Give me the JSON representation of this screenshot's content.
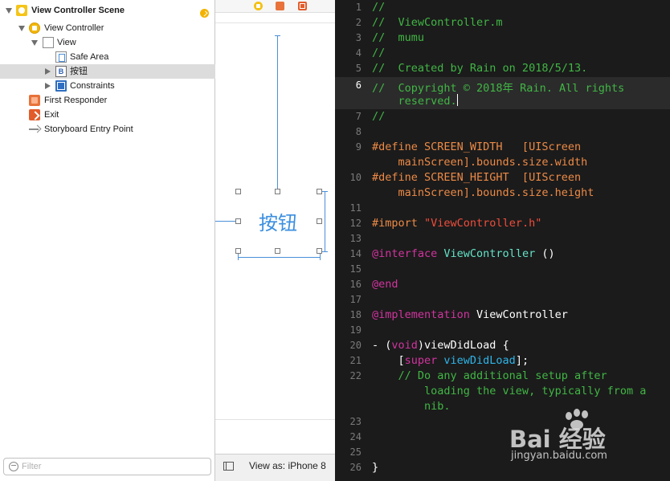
{
  "outline": {
    "items": [
      {
        "label": "View Controller Scene",
        "icon": "scene-icon"
      },
      {
        "label": "View Controller",
        "icon": "view-controller-icon"
      },
      {
        "label": "View",
        "icon": "view-icon"
      },
      {
        "label": "Safe Area",
        "icon": "safe-area-icon"
      },
      {
        "label": "按钮",
        "icon": "button-icon",
        "icon_text": "B",
        "selected": true
      },
      {
        "label": "Constraints",
        "icon": "constraints-icon"
      },
      {
        "label": "First Responder",
        "icon": "first-responder-icon"
      },
      {
        "label": "Exit",
        "icon": "exit-icon"
      },
      {
        "label": "Storyboard Entry Point",
        "icon": "entry-arrow-icon"
      }
    ],
    "filter_placeholder": "Filter"
  },
  "canvas": {
    "button_title": "按钮",
    "view_as_label": "View as: iPhone 8"
  },
  "editor": {
    "lines": [
      {
        "num": "1",
        "text": "//"
      },
      {
        "num": "2",
        "text": "//  ViewController.m"
      },
      {
        "num": "3",
        "text": "//  mumu"
      },
      {
        "num": "4",
        "text": "//"
      },
      {
        "num": "5",
        "text": "//  Created by Rain on 2018/5/13."
      },
      {
        "num": "6",
        "text": "//  Copyright © 2018年 Rain. All rights",
        "cont": "    reserved."
      },
      {
        "num": "7",
        "text": "//"
      },
      {
        "num": "8",
        "text": ""
      },
      {
        "num": "9",
        "text": "#define SCREEN_WIDTH   [UIScreen",
        "cont": "    mainScreen].bounds.size.width"
      },
      {
        "num": "10",
        "text": "#define SCREEN_HEIGHT  [UIScreen",
        "cont": "    mainScreen].bounds.size.height"
      },
      {
        "num": "11",
        "text": ""
      },
      {
        "num": "12",
        "kw": "#import ",
        "str": "\"ViewController.h\""
      },
      {
        "num": "13",
        "text": ""
      },
      {
        "num": "14",
        "kw": "@interface",
        "typ": " ViewController",
        "plain": " ()"
      },
      {
        "num": "15",
        "text": ""
      },
      {
        "num": "16",
        "kw": "@end"
      },
      {
        "num": "17",
        "text": ""
      },
      {
        "num": "18",
        "kw": "@implementation",
        "plain": " ViewController"
      },
      {
        "num": "19",
        "text": ""
      },
      {
        "num": "20",
        "p1": "- (",
        "kw": "void",
        "p2": ")viewDidLoad {"
      },
      {
        "num": "21",
        "p1": "    [",
        "kw": "super",
        "mth": " viewDidLoad",
        "p2": "];"
      },
      {
        "num": "22",
        "text": "    // Do any additional setup after",
        "cont": "        loading the view, typically from a",
        "cont2": "        nib."
      },
      {
        "num": "23",
        "text": ""
      },
      {
        "num": "24",
        "text": ""
      },
      {
        "num": "25",
        "text": ""
      },
      {
        "num": "26",
        "text": "}"
      }
    ],
    "current_line": "6",
    "colors": {
      "background": "#1b1b1b",
      "comment": "#41b645",
      "preprocessor": "#ed8a46",
      "keyword": "#d1349f",
      "string": "#ef4d3c",
      "type": "#64e3c8",
      "method": "#2fb5e9"
    }
  },
  "watermark": {
    "text": "Bai 经验",
    "url": "jingyan.baidu.com"
  }
}
